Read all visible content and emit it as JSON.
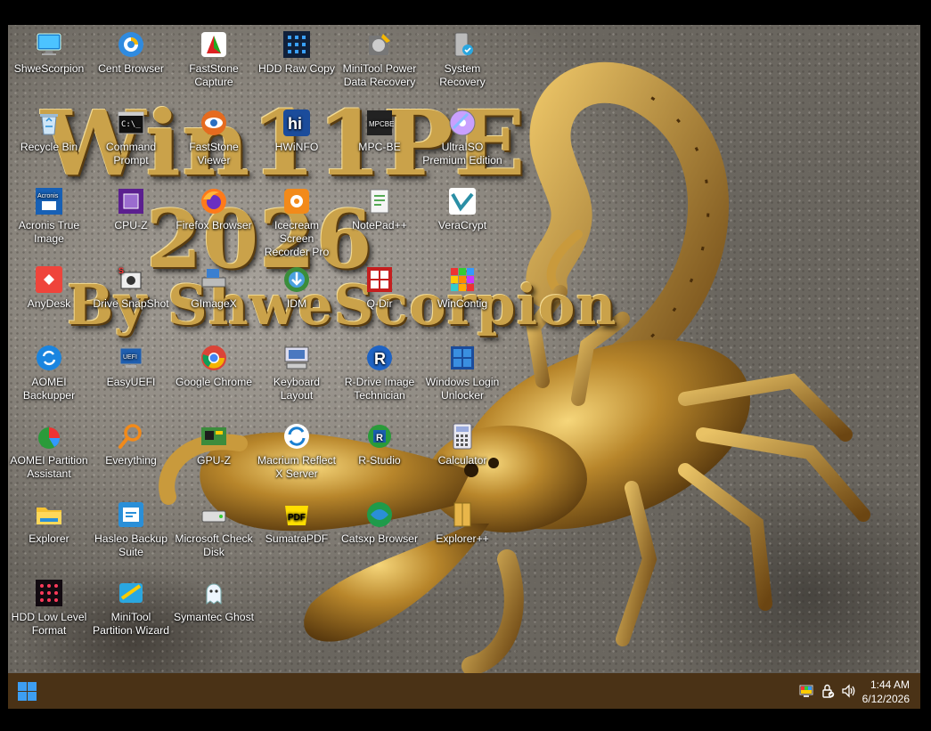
{
  "wallpaper": {
    "title_line1": "Win11PE",
    "title_line2": "2026",
    "title_line3": "By ShweScorpion"
  },
  "desktop_icons": [
    {
      "label": "ShweScorpion",
      "icon": "monitor-icon"
    },
    {
      "label": "Cent Browser",
      "icon": "cent-browser-icon"
    },
    {
      "label": "FastStone Capture",
      "icon": "faststone-capture-icon"
    },
    {
      "label": "HDD Raw Copy",
      "icon": "hdd-raw-copy-icon"
    },
    {
      "label": "MiniTool Power Data Recovery",
      "icon": "minitool-recovery-icon"
    },
    {
      "label": "System Recovery",
      "icon": "system-recovery-icon"
    },
    {
      "label": "Recycle Bin",
      "icon": "recycle-bin-icon"
    },
    {
      "label": "Command Prompt",
      "icon": "command-prompt-icon"
    },
    {
      "label": "FastStone Viewer",
      "icon": "faststone-viewer-icon"
    },
    {
      "label": "HWiNFO",
      "icon": "hwinfo-icon"
    },
    {
      "label": "MPC-BE",
      "icon": "mpc-be-icon"
    },
    {
      "label": "UltraISO Premium Edition",
      "icon": "ultraiso-icon"
    },
    {
      "label": "Acronis True Image",
      "icon": "acronis-icon"
    },
    {
      "label": "CPU-Z",
      "icon": "cpu-z-icon"
    },
    {
      "label": "Firefox Browser",
      "icon": "firefox-icon"
    },
    {
      "label": "Icecream Screen Recorder Pro",
      "icon": "icecream-recorder-icon"
    },
    {
      "label": "NotePad++",
      "icon": "notepad-plus-plus-icon"
    },
    {
      "label": "VeraCrypt",
      "icon": "veracrypt-icon"
    },
    {
      "label": "AnyDesk",
      "icon": "anydesk-icon"
    },
    {
      "label": "Drive SnapShot",
      "icon": "drive-snapshot-icon"
    },
    {
      "label": "GImageX",
      "icon": "gimagex-icon"
    },
    {
      "label": "IDM",
      "icon": "idm-icon"
    },
    {
      "label": "Q-Dir",
      "icon": "q-dir-icon"
    },
    {
      "label": "WinContig",
      "icon": "wincontig-icon"
    },
    {
      "label": "AOMEI Backupper",
      "icon": "aomei-backupper-icon"
    },
    {
      "label": "EasyUEFI",
      "icon": "easyuefi-icon"
    },
    {
      "label": "Google Chrome",
      "icon": "chrome-icon"
    },
    {
      "label": "Keyboard Layout",
      "icon": "keyboard-layout-icon"
    },
    {
      "label": "R-Drive Image Technician",
      "icon": "r-drive-image-icon"
    },
    {
      "label": "Windows Login Unlocker",
      "icon": "login-unlocker-icon"
    },
    {
      "label": "AOMEI Partition Assistant",
      "icon": "aomei-partition-icon"
    },
    {
      "label": "Everything",
      "icon": "everything-search-icon"
    },
    {
      "label": "GPU-Z",
      "icon": "gpu-z-icon"
    },
    {
      "label": "Macrium Reflect X Server",
      "icon": "macrium-reflect-icon"
    },
    {
      "label": "R-Studio",
      "icon": "r-studio-icon"
    },
    {
      "label": "Calculator",
      "icon": "calculator-icon"
    },
    {
      "label": "Explorer",
      "icon": "folder-icon"
    },
    {
      "label": "Hasleo Backup Suite",
      "icon": "hasleo-backup-icon"
    },
    {
      "label": "Microsoft Check Disk",
      "icon": "check-disk-icon"
    },
    {
      "label": "SumatraPDF",
      "icon": "sumatra-pdf-icon"
    },
    {
      "label": "Catsxp Browser",
      "icon": "catsxp-browser-icon"
    },
    {
      "label": "Explorer++",
      "icon": "explorer-plus-plus-icon"
    },
    {
      "label": "HDD Low Level Format",
      "icon": "hdd-low-level-format-icon"
    },
    {
      "label": "MiniTool Partition Wizard",
      "icon": "minitool-partition-icon"
    },
    {
      "label": "Symantec Ghost",
      "icon": "symantec-ghost-icon"
    }
  ],
  "taskbar": {
    "start_icon": "windows-start-icon",
    "tray_icons": [
      "display-color-icon",
      "security-lock-icon",
      "volume-icon"
    ],
    "time": "1:44 AM",
    "date": "6/12/2026"
  },
  "colors": {
    "taskbar_bg": "#4a3216",
    "start_blue": "#3d9ef2",
    "title_gold": "#caa24a"
  }
}
